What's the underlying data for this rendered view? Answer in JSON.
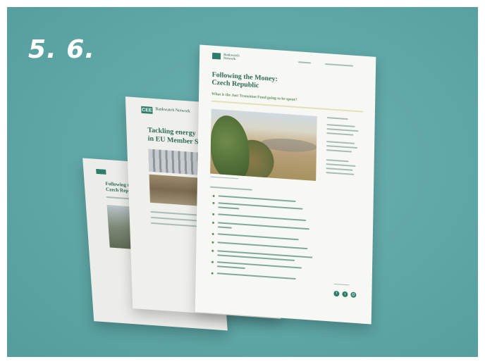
{
  "step": {
    "label": "5. 6."
  },
  "front_page": {
    "title_line1": "Following the Money:",
    "title_line2": "Czech Republic",
    "subtitle": "What is the Just Transition Fund going to be spent?",
    "org_label": "Bankwatch Network"
  },
  "middle_page": {
    "title_line1": "Tackling energy",
    "title_line2": "in EU Member S",
    "org_label": "Bankwatch Network"
  },
  "back_page": {
    "title_line1": "Following the",
    "title_line2": "Czech Republic"
  },
  "colors": {
    "background": "#5fa6a6",
    "brand_green": "#2e7d6b",
    "page_white": "#f7f7f4"
  },
  "icons": [
    "facebook-icon",
    "twitter-icon",
    "link-icon"
  ]
}
